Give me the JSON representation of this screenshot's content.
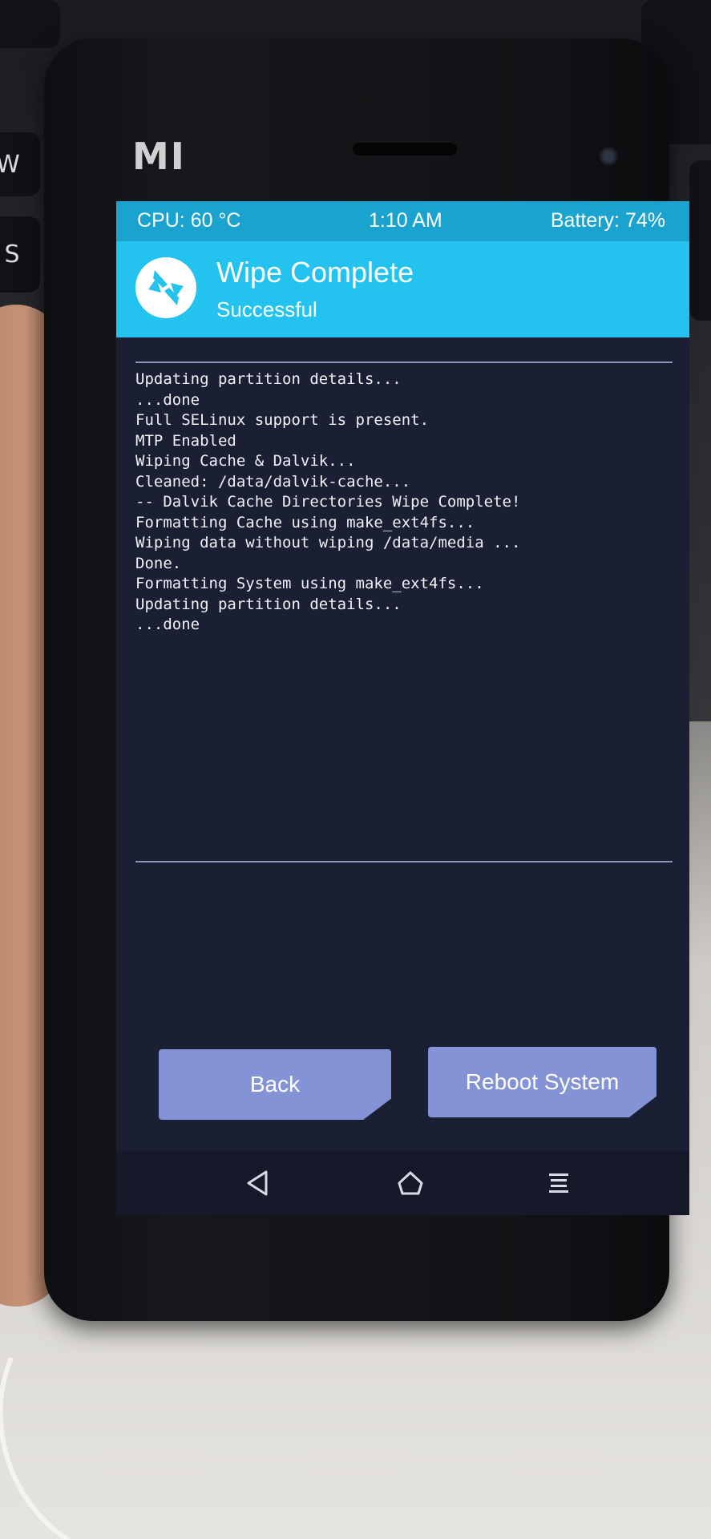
{
  "status_bar": {
    "cpu": "CPU: 60 °C",
    "time": "1:10 AM",
    "battery": "Battery: 74%"
  },
  "header": {
    "title": "Wipe Complete",
    "subtitle": "Successful",
    "logo_icon": "twrp-logo-icon"
  },
  "console": {
    "lines": [
      "Updating partition details...",
      "...done",
      "Full SELinux support is present.",
      "MTP Enabled",
      "Wiping Cache & Dalvik...",
      "Cleaned: /data/dalvik-cache...",
      "-- Dalvik Cache Directories Wipe Complete!",
      "Formatting Cache using make_ext4fs...",
      "Wiping data without wiping /data/media ...",
      "Done.",
      "Formatting System using make_ext4fs...",
      "Updating partition details...",
      "...done"
    ]
  },
  "buttons": {
    "back": "Back",
    "reboot": "Reboot System"
  },
  "navbar": {
    "back_icon": "back-triangle-icon",
    "home_icon": "home-icon",
    "menu_icon": "menu-lines-icon"
  },
  "device": {
    "brand": "MI"
  },
  "keyboard": {
    "keys": [
      "W",
      "S"
    ]
  },
  "colors": {
    "status_bar": "#1aa3cf",
    "header": "#24c3ef",
    "screen_bg": "#1a1f33",
    "button": "#8393d6",
    "console_text": "#f0f2f6"
  }
}
